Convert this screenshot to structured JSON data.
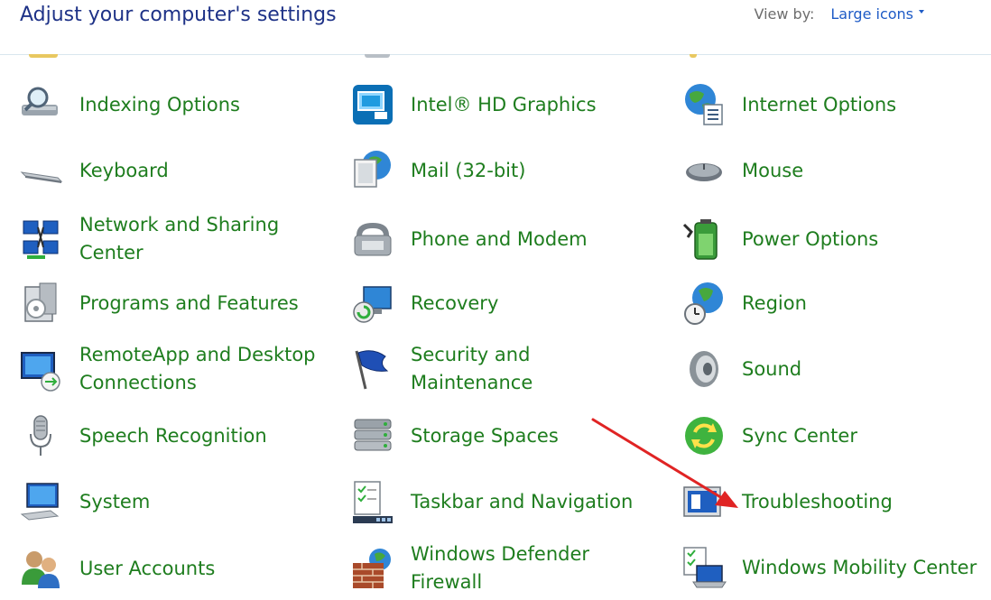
{
  "header": {
    "title": "Adjust your computer's settings",
    "view_by_label": "View by:",
    "view_by_value": "Large icons"
  },
  "colors": {
    "title": "#1e3287",
    "link_green": "#1e7d1e",
    "accent_blue": "#1e5bc6",
    "annotation_arrow": "#e02424"
  },
  "items": [
    {
      "label": "Indexing Options",
      "icon": "indexing-options-icon"
    },
    {
      "label": "Intel® HD Graphics",
      "icon": "intel-hd-graphics-icon"
    },
    {
      "label": "Internet Options",
      "icon": "internet-options-icon"
    },
    {
      "label": "Keyboard",
      "icon": "keyboard-icon"
    },
    {
      "label": "Mail (32-bit)",
      "icon": "mail-icon"
    },
    {
      "label": "Mouse",
      "icon": "mouse-icon"
    },
    {
      "label": "Network and Sharing Center",
      "icon": "network-sharing-icon"
    },
    {
      "label": "Phone and Modem",
      "icon": "phone-modem-icon"
    },
    {
      "label": "Power Options",
      "icon": "power-options-icon"
    },
    {
      "label": "Programs and Features",
      "icon": "programs-features-icon"
    },
    {
      "label": "Recovery",
      "icon": "recovery-icon"
    },
    {
      "label": "Region",
      "icon": "region-icon"
    },
    {
      "label": "RemoteApp and Desktop Connections",
      "icon": "remoteapp-icon"
    },
    {
      "label": "Security and Maintenance",
      "icon": "security-maintenance-icon"
    },
    {
      "label": "Sound",
      "icon": "sound-icon"
    },
    {
      "label": "Speech Recognition",
      "icon": "speech-recognition-icon"
    },
    {
      "label": "Storage Spaces",
      "icon": "storage-spaces-icon"
    },
    {
      "label": "Sync Center",
      "icon": "sync-center-icon"
    },
    {
      "label": "System",
      "icon": "system-icon"
    },
    {
      "label": "Taskbar and Navigation",
      "icon": "taskbar-navigation-icon"
    },
    {
      "label": "Troubleshooting",
      "icon": "troubleshooting-icon"
    },
    {
      "label": "User Accounts",
      "icon": "user-accounts-icon"
    },
    {
      "label": "Windows Defender Firewall",
      "icon": "firewall-icon"
    },
    {
      "label": "Windows Mobility Center",
      "icon": "mobility-center-icon"
    }
  ]
}
